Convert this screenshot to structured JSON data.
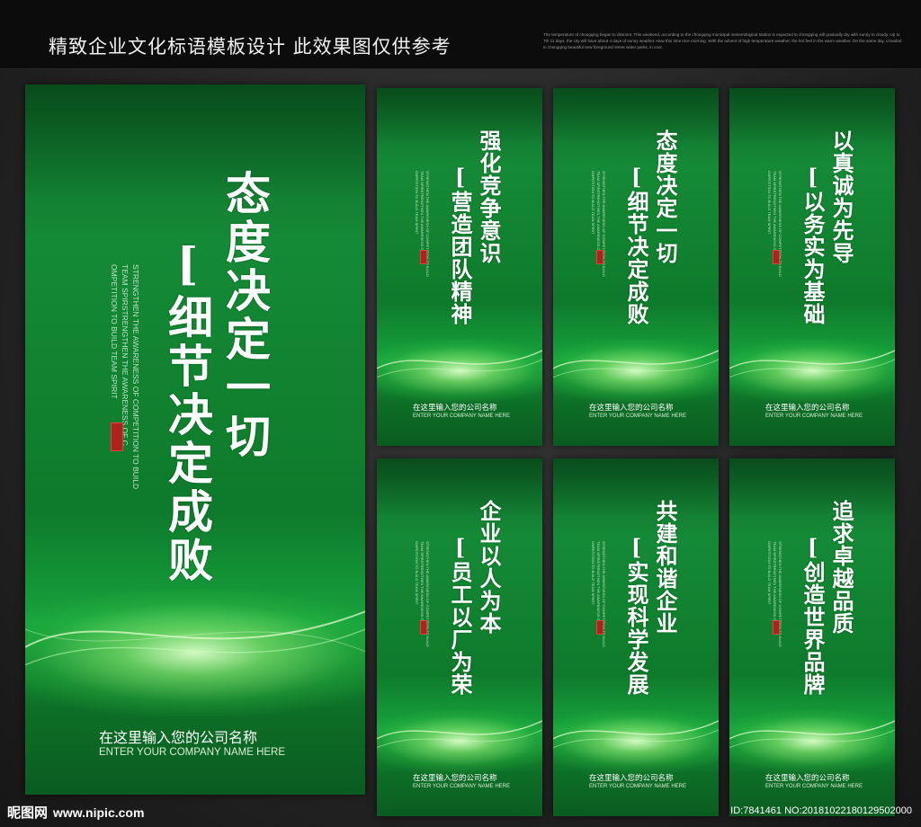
{
  "header": {
    "title": "精致企业文化标语模板设计 此效果图仅供参考",
    "fine_print": "The temperature of chongqing began to descent. This weekend, according to the chongqing municipal meteorological station is expected to chongqing will gradually dry with sunny to cloudy. Up to 7th 11 days, the city will have about 4 days of sunny weather. How this time nice morning. With the advent of high temperature weather, the hot feel in the warm weather. On the same day, crowded in chongqing beautiful new foreground street water parks, in cool."
  },
  "panels": [
    {
      "line1": "态度决定一切",
      "line2": "[细节决定成败",
      "english1": "STRENGTHEN THE AWARENESS OF COMPETITION TO BUILD",
      "english2": "TEAM SPIRSTRENGTHEN THE AWARENESS OF C",
      "english3": "OMPETITION TO BUILD TEAM SPIRIT",
      "company_cn": "在这里输入您的公司名称",
      "company_en": "ENTER YOUR COMPANY NAME HERE"
    },
    {
      "line1": "强化竞争意识",
      "line2": "[营造团队精神",
      "english1": "STRENGTHEN THE AWARENESS OF COMPETITION TO BUILD",
      "english2": "TEAM SPIRSTRENGTHEN THE AWARENESS OF C",
      "english3": "OMPETITION TO BUILD TEAM SPIRIT",
      "company_cn": "在这里输入您的公司名称",
      "company_en": "ENTER YOUR COMPANY NAME HERE"
    },
    {
      "line1": "态度决定一切",
      "line2": "[细节决定成败",
      "english1": "STRENGTHEN THE AWARENESS OF COMPETITION TO BUILD",
      "english2": "TEAM SPIRSTRENGTHEN THE AWARENESS OF C",
      "english3": "OMPETITION TO BUILD TEAM SPIRIT",
      "company_cn": "在这里输入您的公司名称",
      "company_en": "ENTER YOUR COMPANY NAME HERE"
    },
    {
      "line1": "以真诚为先导",
      "line2": "[以务实为基础",
      "english1": "STRENGTHEN THE AWARENESS OF COMPETITION TO BUILD",
      "english2": "TEAM SPIRSTRENGTHEN THE AWARENESS OF C",
      "english3": "OMPETITION TO BUILD TEAM SPIRIT",
      "company_cn": "在这里输入您的公司名称",
      "company_en": "ENTER YOUR COMPANY NAME HERE"
    },
    {
      "line1": "企业以人为本",
      "line2": "[员工以厂为荣",
      "english1": "STRENGTHEN THE AWARENESS OF COMPETITION TO BUILD",
      "english2": "TEAM SPIRSTRENGTHEN THE AWARENESS OF C",
      "english3": "OMPETITION TO BUILD TEAM SPIRIT",
      "company_cn": "在这里输入您的公司名称",
      "company_en": "ENTER YOUR COMPANY NAME HERE"
    },
    {
      "line1": "共建和谐企业",
      "line2": "[实现科学发展",
      "english1": "STRENGTHEN THE AWARENESS OF COMPETITION TO BUILD",
      "english2": "TEAM SPIRSTRENGTHEN THE AWARENESS OF C",
      "english3": "OMPETITION TO BUILD TEAM SPIRIT",
      "company_cn": "在这里输入您的公司名称",
      "company_en": "ENTER YOUR COMPANY NAME HERE"
    },
    {
      "line1": "追求卓越品质",
      "line2": "[创造世界品牌",
      "english1": "STRENGTHEN THE AWARENESS OF COMPETITION TO BUILD",
      "english2": "TEAM SPIRSTRENGTHEN THE AWARENESS OF C",
      "english3": "OMPETITION TO BUILD TEAM SPIRIT",
      "company_cn": "在这里输入您的公司名称",
      "company_en": "ENTER YOUR COMPANY NAME HERE"
    }
  ],
  "watermark": {
    "site_name": "昵图网",
    "url": "www.nipic.com",
    "id_line": "ID:7841461 NO:20181022180129502000"
  },
  "colors": {
    "panel_green": "#10812f",
    "seal_red": "#b0201c",
    "header_bg": "#0c0c0c"
  }
}
